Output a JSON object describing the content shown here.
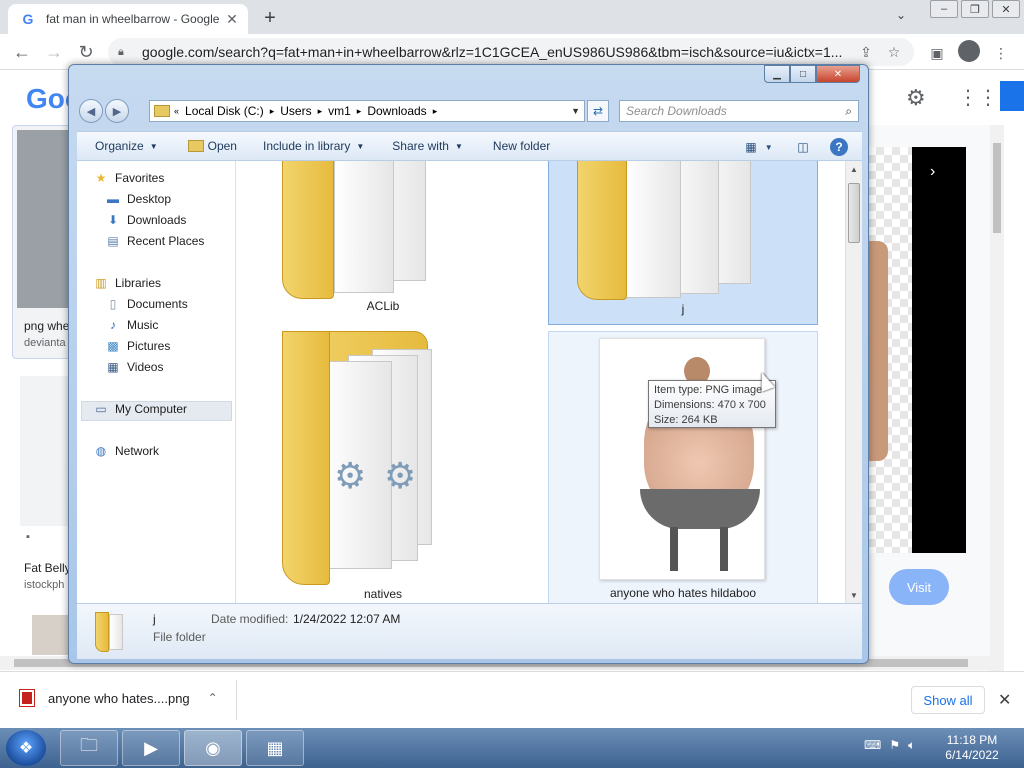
{
  "chrome": {
    "tab_title": "fat man in wheelbarrow - Google",
    "favicon_glyph": "G",
    "url": "google.com/search?q=fat+man+in+wheelbarrow&rlz=1C1GCEA_enUS986US986&tbm=isch&source=iu&ictx=1..."
  },
  "google_page": {
    "logo_text": "Goo",
    "card1_title": "png whe",
    "card1_source": "devianta",
    "card2_title": "Fat Belly",
    "card2_source": "istockph",
    "visit_label": "Visit"
  },
  "explorer": {
    "breadcrumbs": [
      "Local Disk (C:)",
      "Users",
      "vm1",
      "Downloads"
    ],
    "search_placeholder": "Search Downloads",
    "commands": {
      "organize": "Organize",
      "open": "Open",
      "include_in_library": "Include in library",
      "share_with": "Share with",
      "new_folder": "New folder"
    },
    "nav": {
      "favorites": "Favorites",
      "desktop": "Desktop",
      "downloads": "Downloads",
      "recent_places": "Recent Places",
      "libraries": "Libraries",
      "documents": "Documents",
      "music": "Music",
      "pictures": "Pictures",
      "videos": "Videos",
      "my_computer": "My Computer",
      "network": "Network"
    },
    "items": {
      "aclib": "ACLib",
      "j": "j",
      "natives": "natives",
      "png": "anyone who hates hildaboo"
    },
    "tooltip": {
      "type": "Item type: PNG image",
      "dimensions": "Dimensions: 470 x 700",
      "size": "Size: 264 KB"
    },
    "details": {
      "name": "j",
      "type": "File folder",
      "date_label": "Date modified:",
      "date_value": "1/24/2022 12:07 AM"
    }
  },
  "downloads_bar": {
    "file_name": "anyone who hates....png",
    "show_all": "Show all"
  },
  "taskbar": {
    "time": "11:18 PM",
    "date": "6/14/2022"
  }
}
